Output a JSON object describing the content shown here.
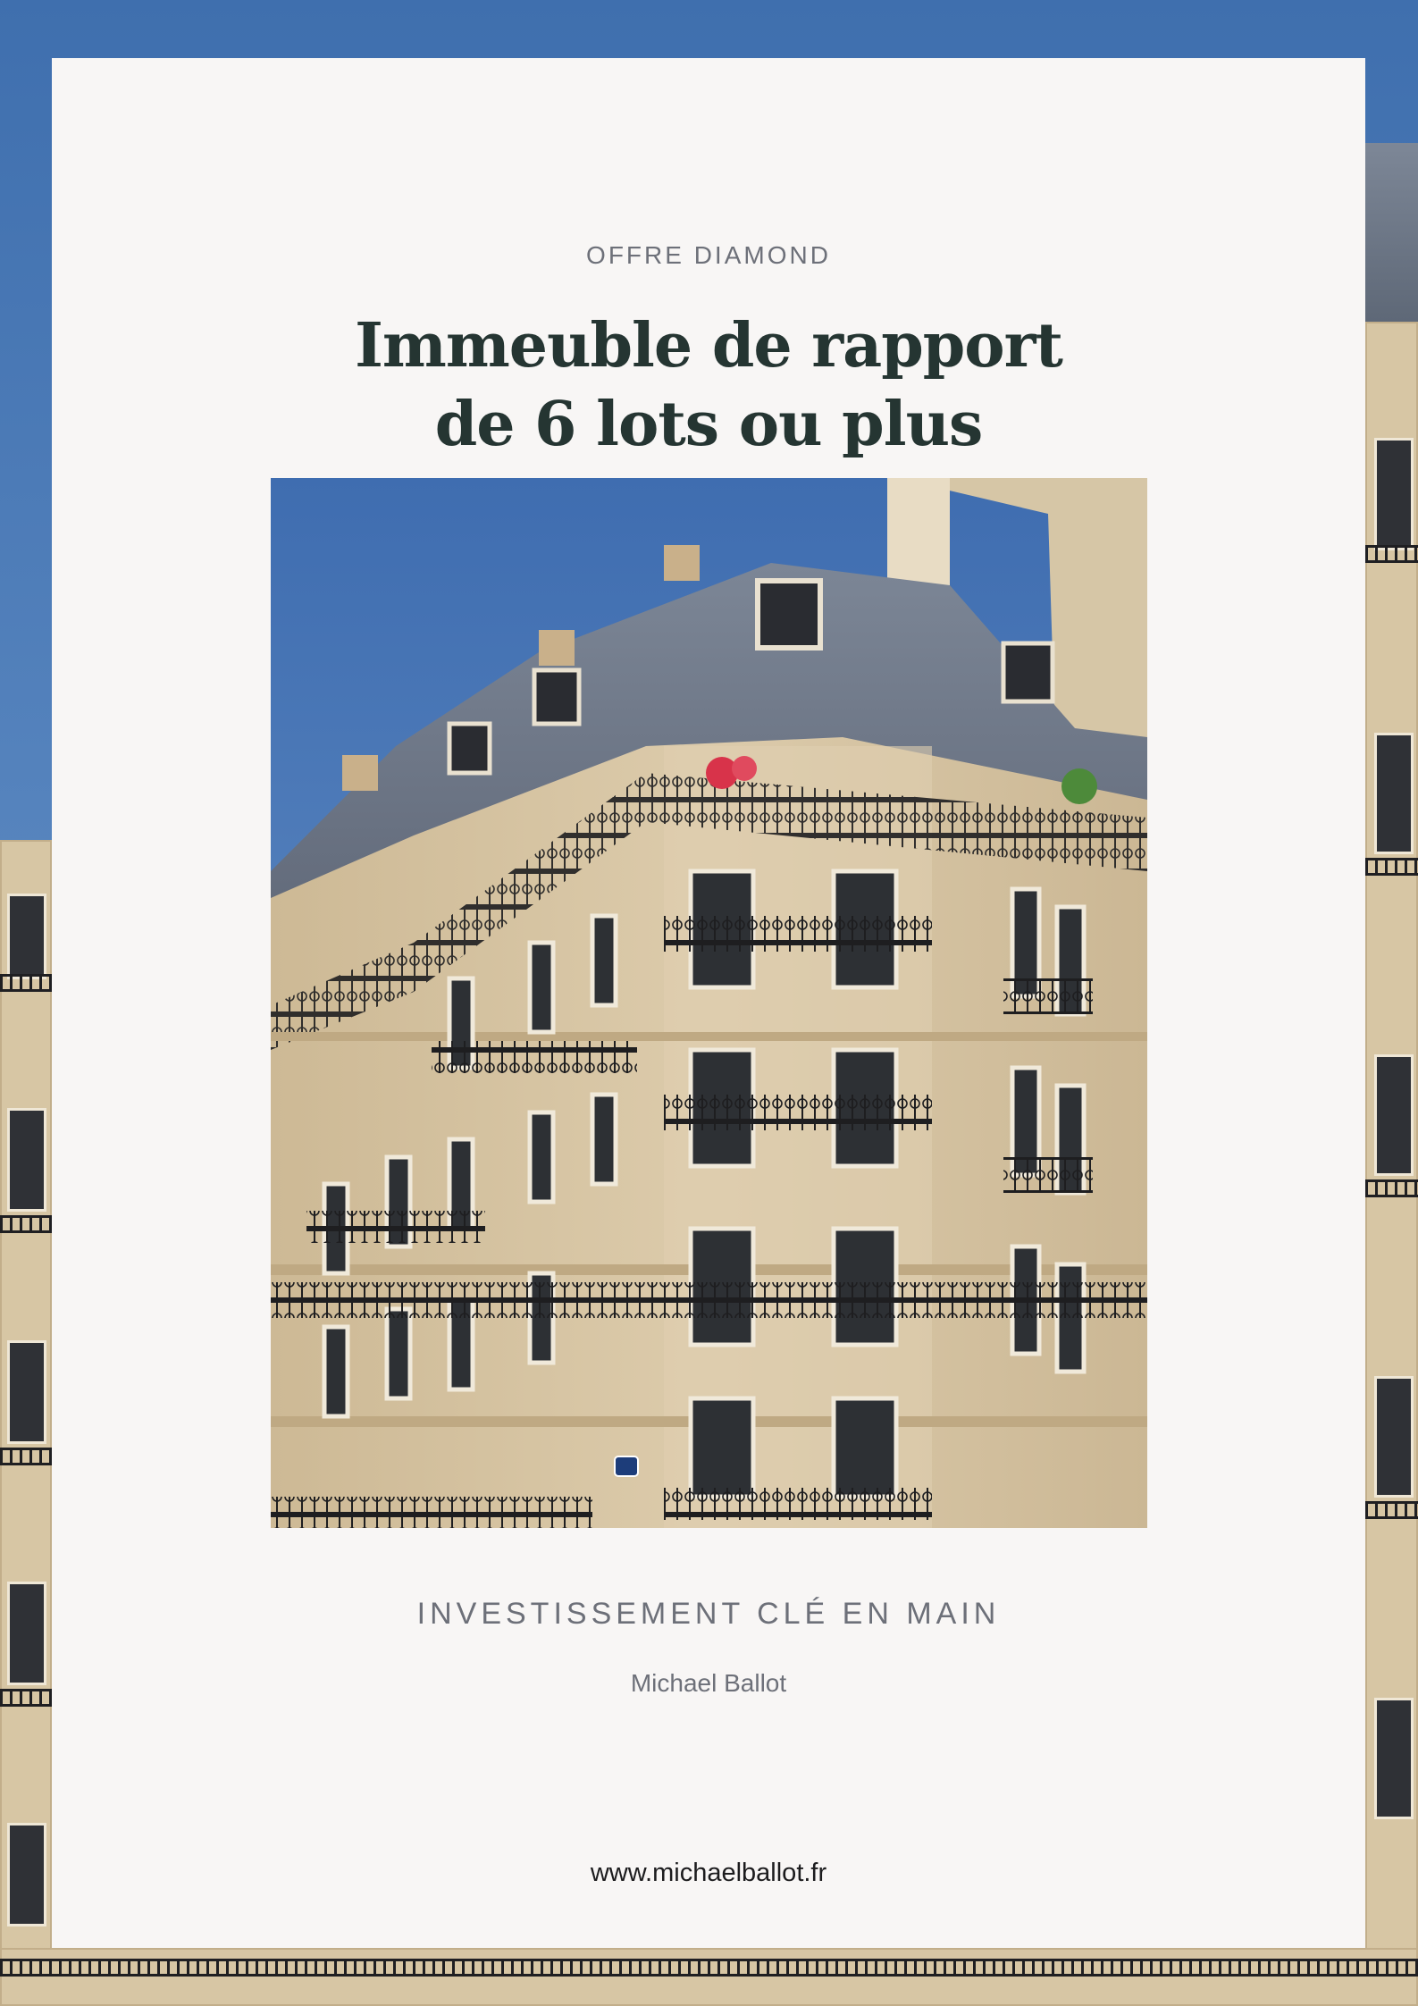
{
  "cover": {
    "offer_label": "OFFRE DIAMOND",
    "title_line_1": "Immeuble de rapport",
    "title_line_2": "de 6 lots ou plus",
    "subtitle": "INVESTISSEMENT CLÉ EN MAIN",
    "author": "Michael Ballot",
    "website": "www.michaelballot.fr"
  },
  "colors": {
    "sky": "#4a78b4",
    "card_background": "#f8f6f5",
    "title_text": "#253532",
    "muted_text": "#6d7079",
    "facade_stone": "#d7c6a4"
  }
}
